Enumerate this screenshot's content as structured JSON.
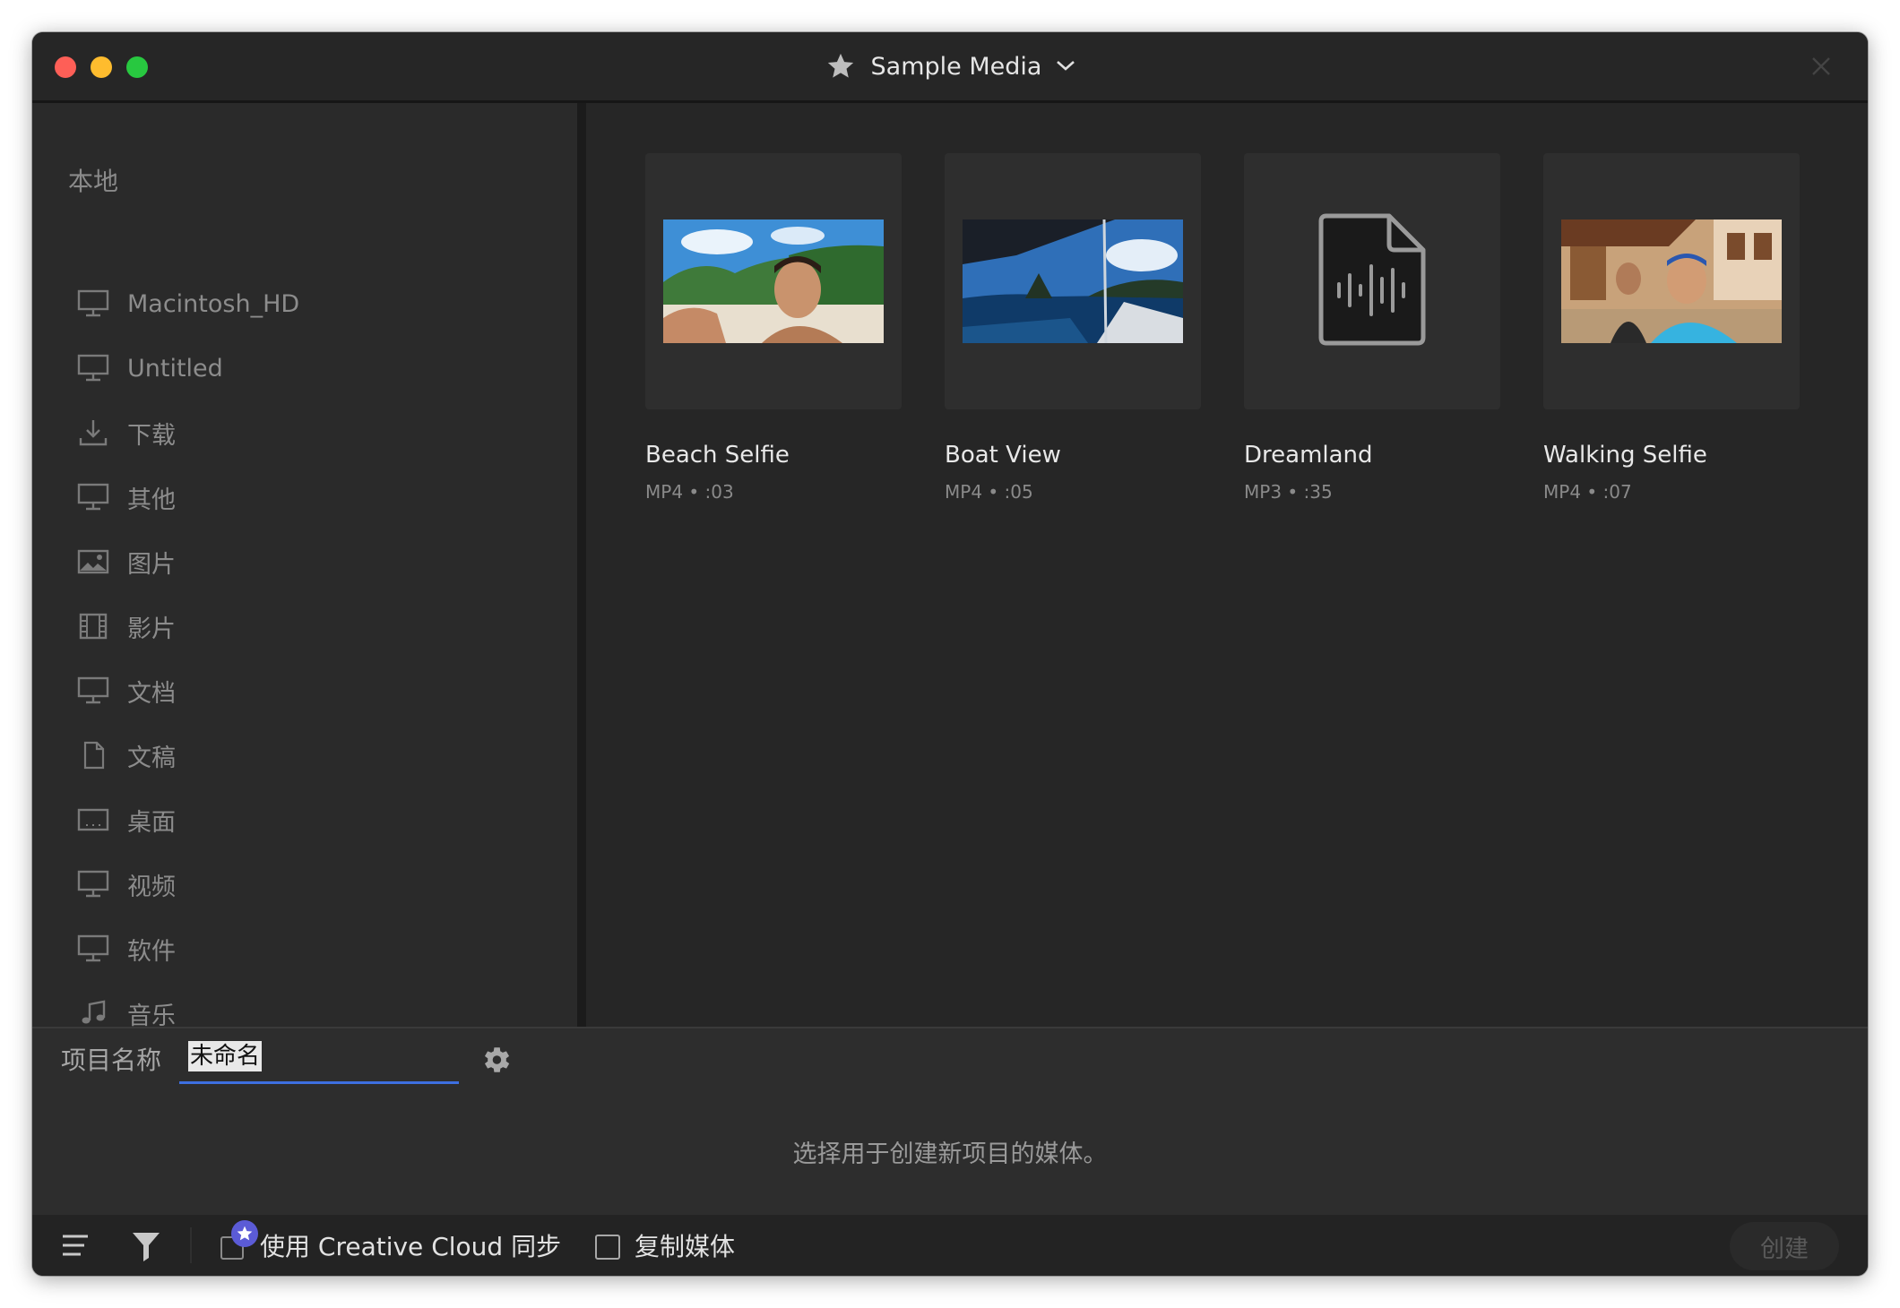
{
  "window": {
    "title": "Sample Media"
  },
  "sidebar": {
    "heading": "本地",
    "items": [
      {
        "label": "Macintosh_HD",
        "icon": "monitor-icon"
      },
      {
        "label": "Untitled",
        "icon": "monitor-icon"
      },
      {
        "label": "下载",
        "icon": "download-icon"
      },
      {
        "label": "其他",
        "icon": "monitor-icon"
      },
      {
        "label": "图片",
        "icon": "image-icon"
      },
      {
        "label": "影片",
        "icon": "film-icon"
      },
      {
        "label": "文档",
        "icon": "monitor-icon"
      },
      {
        "label": "文稿",
        "icon": "document-icon"
      },
      {
        "label": "桌面",
        "icon": "desktop-icon"
      },
      {
        "label": "视频",
        "icon": "monitor-icon"
      },
      {
        "label": "软件",
        "icon": "monitor-icon"
      },
      {
        "label": "音乐",
        "icon": "music-note-icon"
      }
    ]
  },
  "media": [
    {
      "title": "Beach Selfie",
      "meta": "MP4 • :03",
      "kind": "video"
    },
    {
      "title": "Boat View",
      "meta": "MP4 • :05",
      "kind": "video"
    },
    {
      "title": "Dreamland",
      "meta": "MP3 • :35",
      "kind": "audio"
    },
    {
      "title": "Walking Selfie",
      "meta": "MP4 • :07",
      "kind": "video"
    }
  ],
  "project": {
    "label": "项目名称",
    "name_value": "未命名",
    "hint": "选择用于创建新项目的媒体。"
  },
  "bottombar": {
    "cc_sync_label": "使用 Creative Cloud 同步",
    "copy_media_label": "复制媒体",
    "create_label": "创建"
  },
  "colors": {
    "accent_blue": "#3d6fe0",
    "cc_badge": "#5b5bd6"
  }
}
